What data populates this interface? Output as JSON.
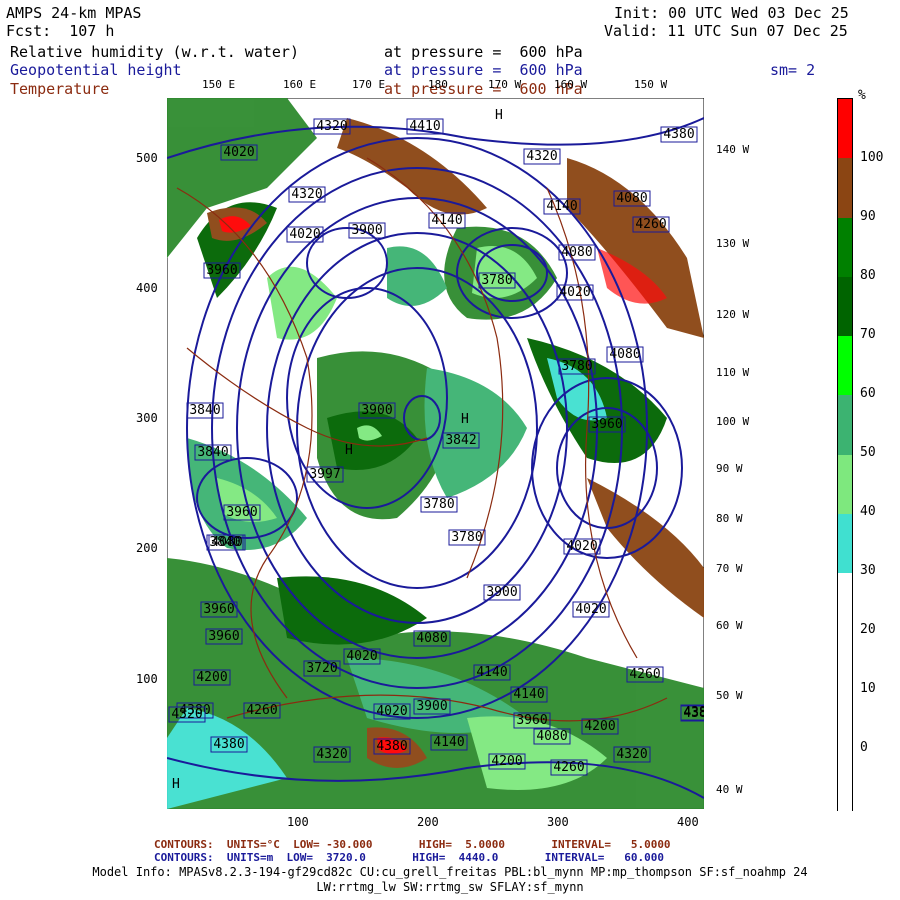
{
  "header": {
    "model": "AMPS 24-km MPAS",
    "fcst": "Fcst:  107 h",
    "init": "Init: 00 UTC Wed 03 Dec 25",
    "valid": "Valid: 11 UTC Sun 07 Dec 25",
    "fields": [
      {
        "name": "Relative humidity (w.r.t. water)",
        "pressure": "at pressure =  600 hPa"
      },
      {
        "name": "Geopotential height",
        "pressure": "at pressure =  600 hPa"
      },
      {
        "name": "Temperature",
        "pressure": "at pressure =  600 hPa"
      }
    ],
    "smoothing": "sm= 2"
  },
  "y_ticks": [
    "500",
    "400",
    "300",
    "200",
    "100"
  ],
  "x_ticks": [
    "100",
    "200",
    "300",
    "400"
  ],
  "lon_top": [
    "150 E",
    "160 E",
    "170 E",
    "180",
    "170 W",
    "160 W",
    "150 W"
  ],
  "lon_right": [
    "140 W",
    "130 W",
    "120 W",
    "110 W",
    "100 W",
    "90 W",
    "80 W",
    "70 W",
    "60 W",
    "50 W",
    "40 W"
  ],
  "colorbar": {
    "unit": "%",
    "labels": [
      "100",
      "90",
      "80",
      "70",
      "60",
      "50",
      "40",
      "30",
      "20",
      "10",
      "0"
    ],
    "colors": [
      "#ff0000",
      "#8b4513",
      "#008000",
      "#006400",
      "#00ff00",
      "#3cb371",
      "#7ee87e",
      "#40e0d0",
      "#ffffff",
      "#ffffff",
      "#ffffff",
      "#ffffff"
    ]
  },
  "height_labels": [
    "4320",
    "4410",
    "4380",
    "4020",
    "4320",
    "4320",
    "4080",
    "4140",
    "4020",
    "4260",
    "3900",
    "4140",
    "3960",
    "3780",
    "4080",
    "4020",
    "4080",
    "3840",
    "3780",
    "3900",
    "3842",
    "3840",
    "3960",
    "3997",
    "3960",
    "4080",
    "3840",
    "3780",
    "3780",
    "4020",
    "3900",
    "3960",
    "4020",
    "3960",
    "4080",
    "4020",
    "4140",
    "3720",
    "3900",
    "4140",
    "4260",
    "4200",
    "4380",
    "4260",
    "4020",
    "3960",
    "4080",
    "4200",
    "4380",
    "4380",
    "4320",
    "4380",
    "4140",
    "4200",
    "4260",
    "4320",
    "4380",
    "4320"
  ],
  "footer": {
    "temp_contours": "CONTOURS:  UNITS=°C  LOW= -30.000       HIGH=  5.0000       INTERVAL=   5.0000",
    "height_contours": "CONTOURS:  UNITS=m  LOW=  3720.0       HIGH=  4440.0       INTERVAL=   60.000",
    "model_info_1": "Model Info: MPASv8.2.3-194-gf29cd82c CU:cu_grell_freitas PBL:bl_mynn MP:mp_thompson SF:sf_noahmp 24",
    "model_info_2": "LW:rrtmg_lw SW:rrtmg_sw SFLAY:sf_mynn"
  }
}
